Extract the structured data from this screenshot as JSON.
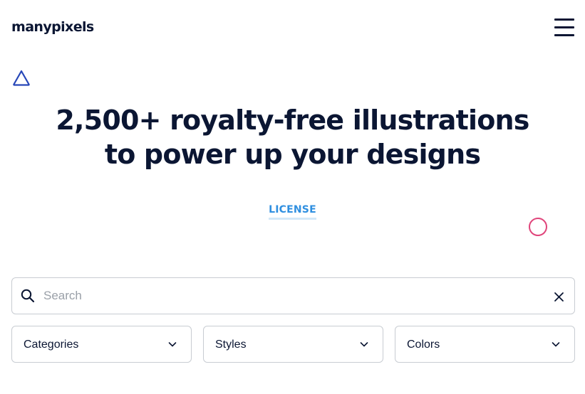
{
  "header": {
    "logo_text": "manypixels",
    "menu_icon": "hamburger-menu-icon"
  },
  "decorations": {
    "triangle_color": "#2747b8",
    "circle_color": "#e0457b"
  },
  "hero": {
    "title_line1": "2,500+ royalty-free illustrations",
    "title_line2": "to power up your designs",
    "license_label": "LICENSE"
  },
  "search": {
    "placeholder": "Search",
    "value": "",
    "search_icon": "search-icon",
    "clear_icon": "close-icon"
  },
  "filters": [
    {
      "label": "Categories",
      "icon": "chevron-down-icon"
    },
    {
      "label": "Styles",
      "icon": "chevron-down-icon"
    },
    {
      "label": "Colors",
      "icon": "chevron-down-icon"
    }
  ],
  "colors": {
    "text_primary": "#0b1633",
    "accent_link": "#2f8fe0",
    "border": "#c8ccd2"
  }
}
